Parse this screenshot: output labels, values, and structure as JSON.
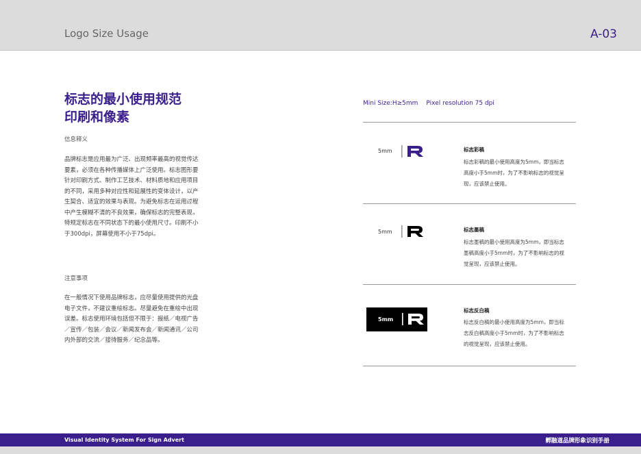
{
  "header": {
    "title": "Logo Size Usage",
    "page_code": "A-03"
  },
  "left": {
    "heading_line1": "标志的最小使用规范",
    "heading_line2": "印刷和像素",
    "info_label": "信息释义",
    "info_paragraph": "品牌标志是应用最为广泛、出现频率最高的视觉传达要素，必须在各种传播媒体上广泛使用。标志图形要针对印刷方式、制作工艺技术、材料质地和应用项目的不同，采用多种对应性和延展性的变体设计，以产生契合、适宜的效果与表现。为避免标志在运用过程中产生模糊不清的不良效果，确保标志的完整表现，特规定标志在不同状态下的最小使用尺寸。印刷不小于300dpi，屏幕使用不小于75dpi。",
    "notes_label": "注意事项",
    "notes_paragraph": "在一般情况下使用品牌标志，应尽量使用提供的光盘电子文件，不建议重绘标志。尽量避免在重绘中出现误差。标志使用环境包括但不限于：报纸／电视广告／宣传／包装／会议／新闻发布会／新闻通讯／公司内外部的交流／接待服务／纪念品等。"
  },
  "right": {
    "spec_min": "Mini Size:H≥5mm",
    "spec_pixel": "Pixel resolution 75 dpi",
    "items": [
      {
        "size": "5mm",
        "title": "标志彩稿",
        "desc": "标志彩稿的最小使用高度为5mm，即当标志高度小于5mm时，为了不影响标志的视觉呈现，应该禁止使用。",
        "logo_color": "#3a1f8c",
        "icon": "brand-logo-color-icon"
      },
      {
        "size": "5mm",
        "title": "标志墨稿",
        "desc": "标志墨稿的最小使用高度为5mm，即当标志墨稿高度小于5mm时，为了不影响标志的视觉呈现，应该禁止使用。",
        "logo_color": "#000000",
        "icon": "brand-logo-black-icon"
      },
      {
        "size": "5mm",
        "title": "标志反白稿",
        "desc": "标志反白稿的最小使用高度为5mm，即当标志反白稿高度小于5mm时，为了不影响标志的视觉呈现，应该禁止使用。",
        "logo_color": "#ffffff",
        "icon": "brand-logo-white-icon"
      }
    ]
  },
  "footer": {
    "left": "Visual Identity System For Sign Advert",
    "right": "孵融道品牌形象识别手册"
  },
  "colors": {
    "brand_purple": "#3a1f8c",
    "header_gray": "#dcdcdc"
  }
}
